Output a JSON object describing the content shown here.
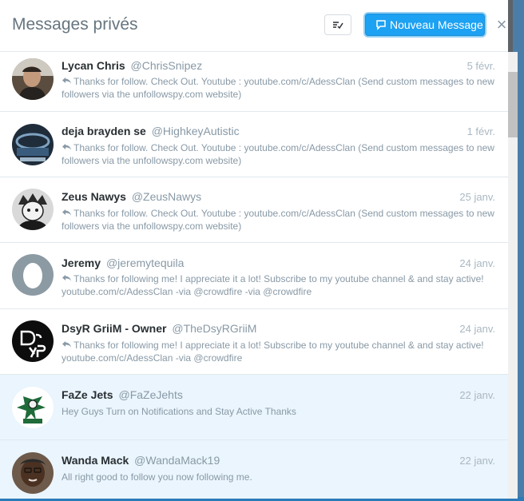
{
  "header": {
    "title": "Messages privés",
    "new_message_label": "Nouveau Message",
    "close_symbol": "×"
  },
  "colors": {
    "accent": "#1da1f2",
    "unread_bg": "#eaf5fd",
    "muted": "#8899a6"
  },
  "conversations": [
    {
      "name": "Lycan Chris",
      "handle": "@ChrisSnipez",
      "date": "5 févr.",
      "snippet": "Thanks for follow. Check Out. Youtube : youtube.com/c/AdessClan (Send custom messages to new followers via the unfollowspy.com website)",
      "replied": true,
      "unread": false,
      "avatar_icon": "person-photo-avatar"
    },
    {
      "name": "deja brayden se",
      "handle": "@HighkeyAutistic",
      "date": "1 févr.",
      "snippet": "Thanks for follow. Check Out. Youtube : youtube.com/c/AdessClan (Send custom messages to new followers via the unfollowspy.com website)",
      "replied": true,
      "unread": false,
      "avatar_icon": "stadium-avatar"
    },
    {
      "name": "Zeus Nawys",
      "handle": "@ZeusNawys",
      "date": "25 janv.",
      "snippet": "Thanks for follow. Check Out. Youtube : youtube.com/c/AdessClan (Send custom messages to new followers via the unfollowspy.com website)",
      "replied": true,
      "unread": false,
      "avatar_icon": "anime-character-avatar"
    },
    {
      "name": "Jeremy",
      "handle": "@jeremytequila",
      "date": "24 janv.",
      "snippet": "Thanks for following me! I appreciate it a lot! Subscribe to my youtube channel & and stay active! youtube.com/c/AdessClan -via @crowdfire -via @crowdfire",
      "replied": true,
      "unread": false,
      "avatar_icon": "default-egg-avatar"
    },
    {
      "name": "DsyR GriiM - Owner",
      "handle": "@TheDsyRGriiM",
      "date": "24 janv.",
      "snippet": "Thanks for following me! I appreciate it a lot! Subscribe to my youtube channel & and stay active! youtube.com/c/AdessClan -via @crowdfire",
      "replied": true,
      "unread": false,
      "avatar_icon": "dsyr-logo-avatar"
    },
    {
      "name": "FaZe Jets",
      "handle": "@FaZeJehts",
      "date": "22 janv.",
      "snippet": "Hey Guys Turn on Notifications and Stay Active Thanks",
      "replied": false,
      "unread": true,
      "avatar_icon": "jets-logo-avatar"
    },
    {
      "name": "Wanda Mack",
      "handle": "@WandaMack19",
      "date": "22 janv.",
      "snippet": "All right good to follow you now following me.",
      "replied": false,
      "unread": true,
      "avatar_icon": "person-photo-avatar"
    }
  ]
}
